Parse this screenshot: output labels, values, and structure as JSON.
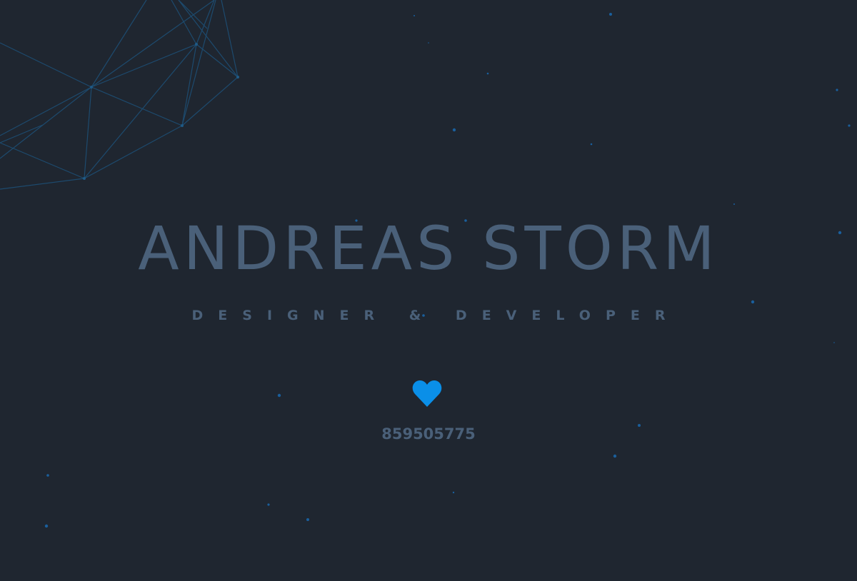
{
  "header": {
    "name": "ANDREAS STORM",
    "tagline": "DESIGNER & DEVELOPER"
  },
  "like": {
    "icon": "heart-icon",
    "count": "859505775",
    "color": "#0a8fe8"
  },
  "colors": {
    "background": "#1f2630",
    "text": "#4a6079",
    "mesh": "#1f5a86",
    "particles": "#1a6db3"
  }
}
